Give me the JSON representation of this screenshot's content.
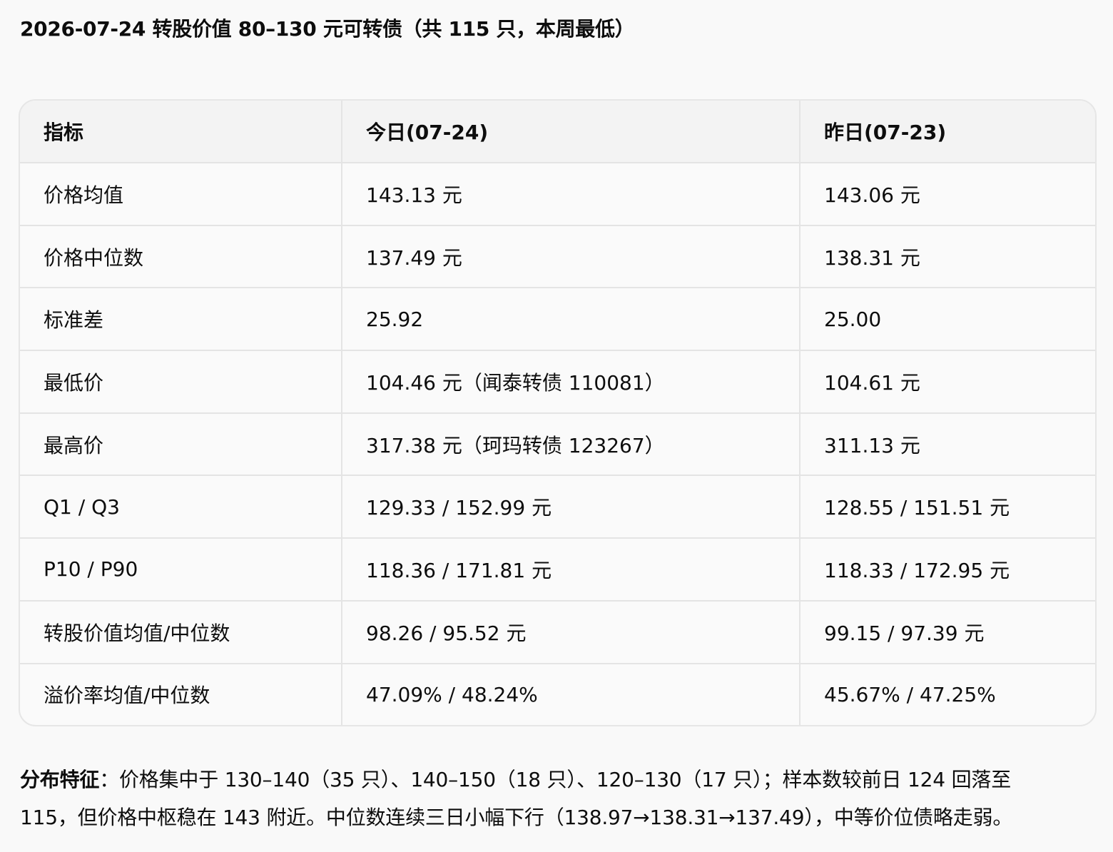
{
  "title": "2026-07-24 转股价值 80–130 元可转债（共 115 只，本周最低）",
  "table": {
    "headers": [
      "指标",
      "今日(07-24)",
      "昨日(07-23)"
    ],
    "rows": [
      [
        "价格均值",
        "143.13 元",
        "143.06 元"
      ],
      [
        "价格中位数",
        "137.49 元",
        "138.31 元"
      ],
      [
        "标准差",
        "25.92",
        "25.00"
      ],
      [
        "最低价",
        "104.46 元（闻泰转债 110081）",
        "104.61 元"
      ],
      [
        "最高价",
        "317.38 元（珂玛转债 123267）",
        "311.13 元"
      ],
      [
        "Q1 / Q3",
        "129.33 / 152.99 元",
        "128.55 / 151.51 元"
      ],
      [
        "P10 / P90",
        "118.36 / 171.81 元",
        "118.33 / 172.95 元"
      ],
      [
        "转股价值均值/中位数",
        "98.26 / 95.52 元",
        "99.15 / 97.39 元"
      ],
      [
        "溢价率均值/中位数",
        "47.09% / 48.24%",
        "45.67% / 47.25%"
      ]
    ]
  },
  "notes": {
    "label": "分布特征",
    "line1": "：价格集中于 130–140（35 只）、140–150（18 只）、120–130（17 只）；样本数较前日 124 回落至",
    "line2": "115，但价格中枢稳在 143 附近。中位数连续三日小幅下行（138.97→138.31→137.49），中等价位债略走弱。"
  }
}
